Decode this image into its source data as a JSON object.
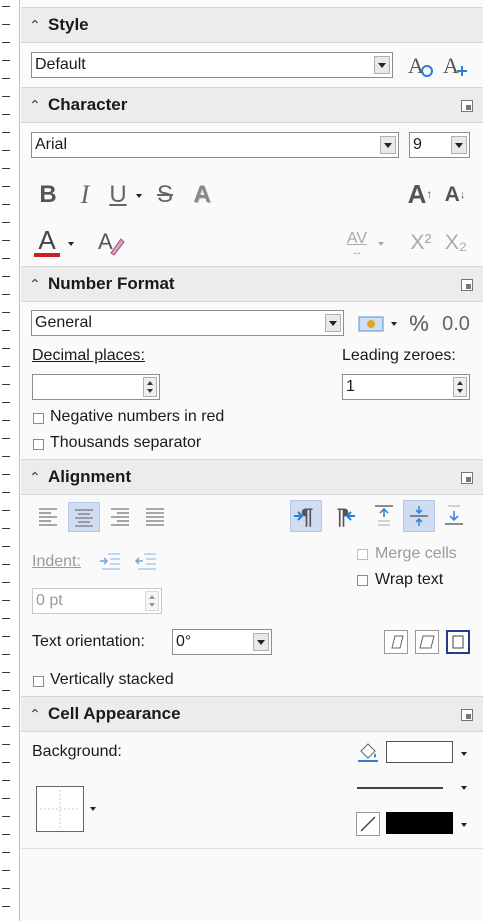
{
  "style": {
    "title": "Style",
    "value": "Default",
    "update_icon": "update-style-icon",
    "new_icon": "new-style-icon"
  },
  "character": {
    "title": "Character",
    "font_name": "Arial",
    "font_size": "9",
    "bold_glyph": "B",
    "italic_glyph": "I",
    "underline_glyph": "U",
    "strike_glyph": "S",
    "shadow_glyph": "A",
    "grow_glyph": "A",
    "shrink_glyph": "A",
    "font_color_glyph": "A",
    "font_color": "#c9211e",
    "highlight_glyph": "A",
    "spacing_glyph": "AV",
    "superscript_glyph": "X²",
    "subscript_glyph": "X₂"
  },
  "number_format": {
    "title": "Number Format",
    "category": "General",
    "percent_glyph": "%",
    "decimal_glyph": "0.0",
    "decimal_places_label": "Decimal places:",
    "decimal_places_value": "",
    "leading_zeroes_label": "Leading zeroes:",
    "leading_zeroes_value": "1",
    "negative_red_label": "Negative numbers in red",
    "thousands_label": "Thousands separator"
  },
  "alignment": {
    "title": "Alignment",
    "indent_label": "Indent:",
    "indent_value": "0 pt",
    "merge_label": "Merge cells",
    "wrap_label": "Wrap text",
    "orientation_label": "Text orientation:",
    "orientation_value": "0°",
    "stacked_label": "Vertically stacked"
  },
  "cell_appearance": {
    "title": "Cell Appearance",
    "background_label": "Background:",
    "background_color": "#ffffff",
    "line_color": "#000000"
  }
}
